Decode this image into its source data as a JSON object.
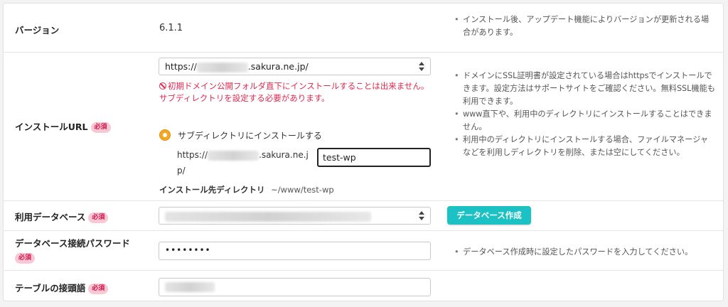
{
  "version_row": {
    "label": "バージョン",
    "value": "6.1.1",
    "notes": [
      "インストール後、アップデート機能によりバージョンが更新される場合があります。"
    ]
  },
  "url_row": {
    "label": "インストールURL",
    "required_badge": "必須",
    "domain_select_prefix": "https://",
    "domain_select_suffix": ".sakura.ne.jp/",
    "error_line1": "初期ドメイン公開フォルダ直下にインストールすることは出来ません。",
    "error_line2": "サブディレクトリを設定する必要があります。",
    "radio_label": "サブディレクトリにインストールする",
    "subdir_prefix": "https://",
    "subdir_suffix_1": ".sakura.ne.j",
    "subdir_suffix_2": "p/",
    "subdir_value": "test-wp",
    "dest_label": "インストール先ディレクトリ",
    "dest_value": "~/www/test-wp",
    "notes": [
      "ドメインにSSL証明書が設定されている場合はhttpsでインストールできます。設定方法はサポートサイトをご確認ください。無料SSL機能も利用できます。",
      "www直下や、利用中のディレクトリにインストールすることはできません。",
      "利用中のディレクトリにインストールする場合、ファイルマネージャなどを利用しディレクトリを削除、または空にしてください。"
    ]
  },
  "db_row": {
    "label": "利用データベース",
    "required_badge": "必須",
    "create_button": "データベース作成"
  },
  "password_row": {
    "label": "データベース接続パスワード",
    "required_badge": "必須",
    "value": "••••••••",
    "notes": [
      "データベース作成時に設定したパスワードを入力してください。"
    ]
  },
  "prefix_row": {
    "label": "テーブルの接頭語",
    "required_badge": "必須"
  }
}
